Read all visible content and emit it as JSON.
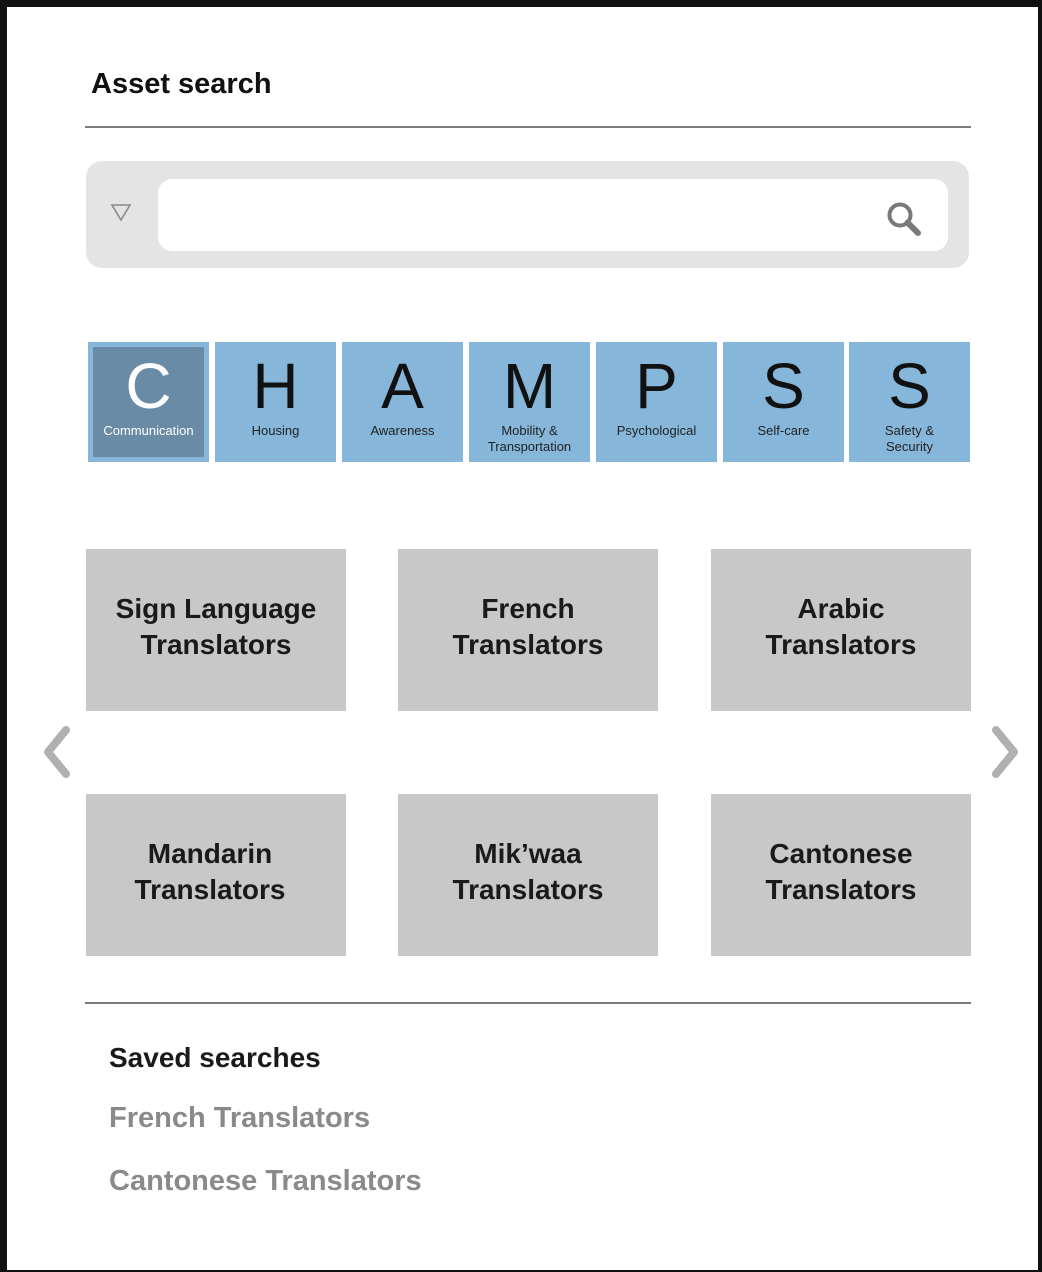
{
  "page": {
    "title": "Asset search"
  },
  "search": {
    "value": "",
    "placeholder": "",
    "filter_icon": "triangle-down-outline-icon",
    "search_icon": "magnifier-icon"
  },
  "champs": [
    {
      "letter": "C",
      "label": "Communication",
      "active": true
    },
    {
      "letter": "H",
      "label": "Housing",
      "active": false
    },
    {
      "letter": "A",
      "label": "Awareness",
      "active": false
    },
    {
      "letter": "M",
      "label": "Mobility &\nTransportation",
      "active": false
    },
    {
      "letter": "P",
      "label": "Psychological",
      "active": false
    },
    {
      "letter": "S",
      "label": "Self-care",
      "active": false
    },
    {
      "letter": "S",
      "label": "Safety &\nSecurity",
      "active": false
    }
  ],
  "results": [
    {
      "label": "Sign Language\nTranslators"
    },
    {
      "label": "French\nTranslators"
    },
    {
      "label": "Arabic\nTranslators"
    },
    {
      "label": "Mandarin\nTranslators"
    },
    {
      "label": "Mik’waa\nTranslators"
    },
    {
      "label": "Cantonese\nTranslators"
    }
  ],
  "carousel": {
    "prev_icon": "chevron-left-icon",
    "next_icon": "chevron-right-icon"
  },
  "saved": {
    "title": "Saved searches",
    "items": [
      "French Translators",
      "Cantonese Translators"
    ]
  },
  "colors": {
    "champ_tile": "#86b6d9",
    "champ_active": "#6a8ba6",
    "result_tile": "#c8c8c8",
    "search_bg": "#e4e4e4",
    "muted_text": "#8a8a8a"
  }
}
